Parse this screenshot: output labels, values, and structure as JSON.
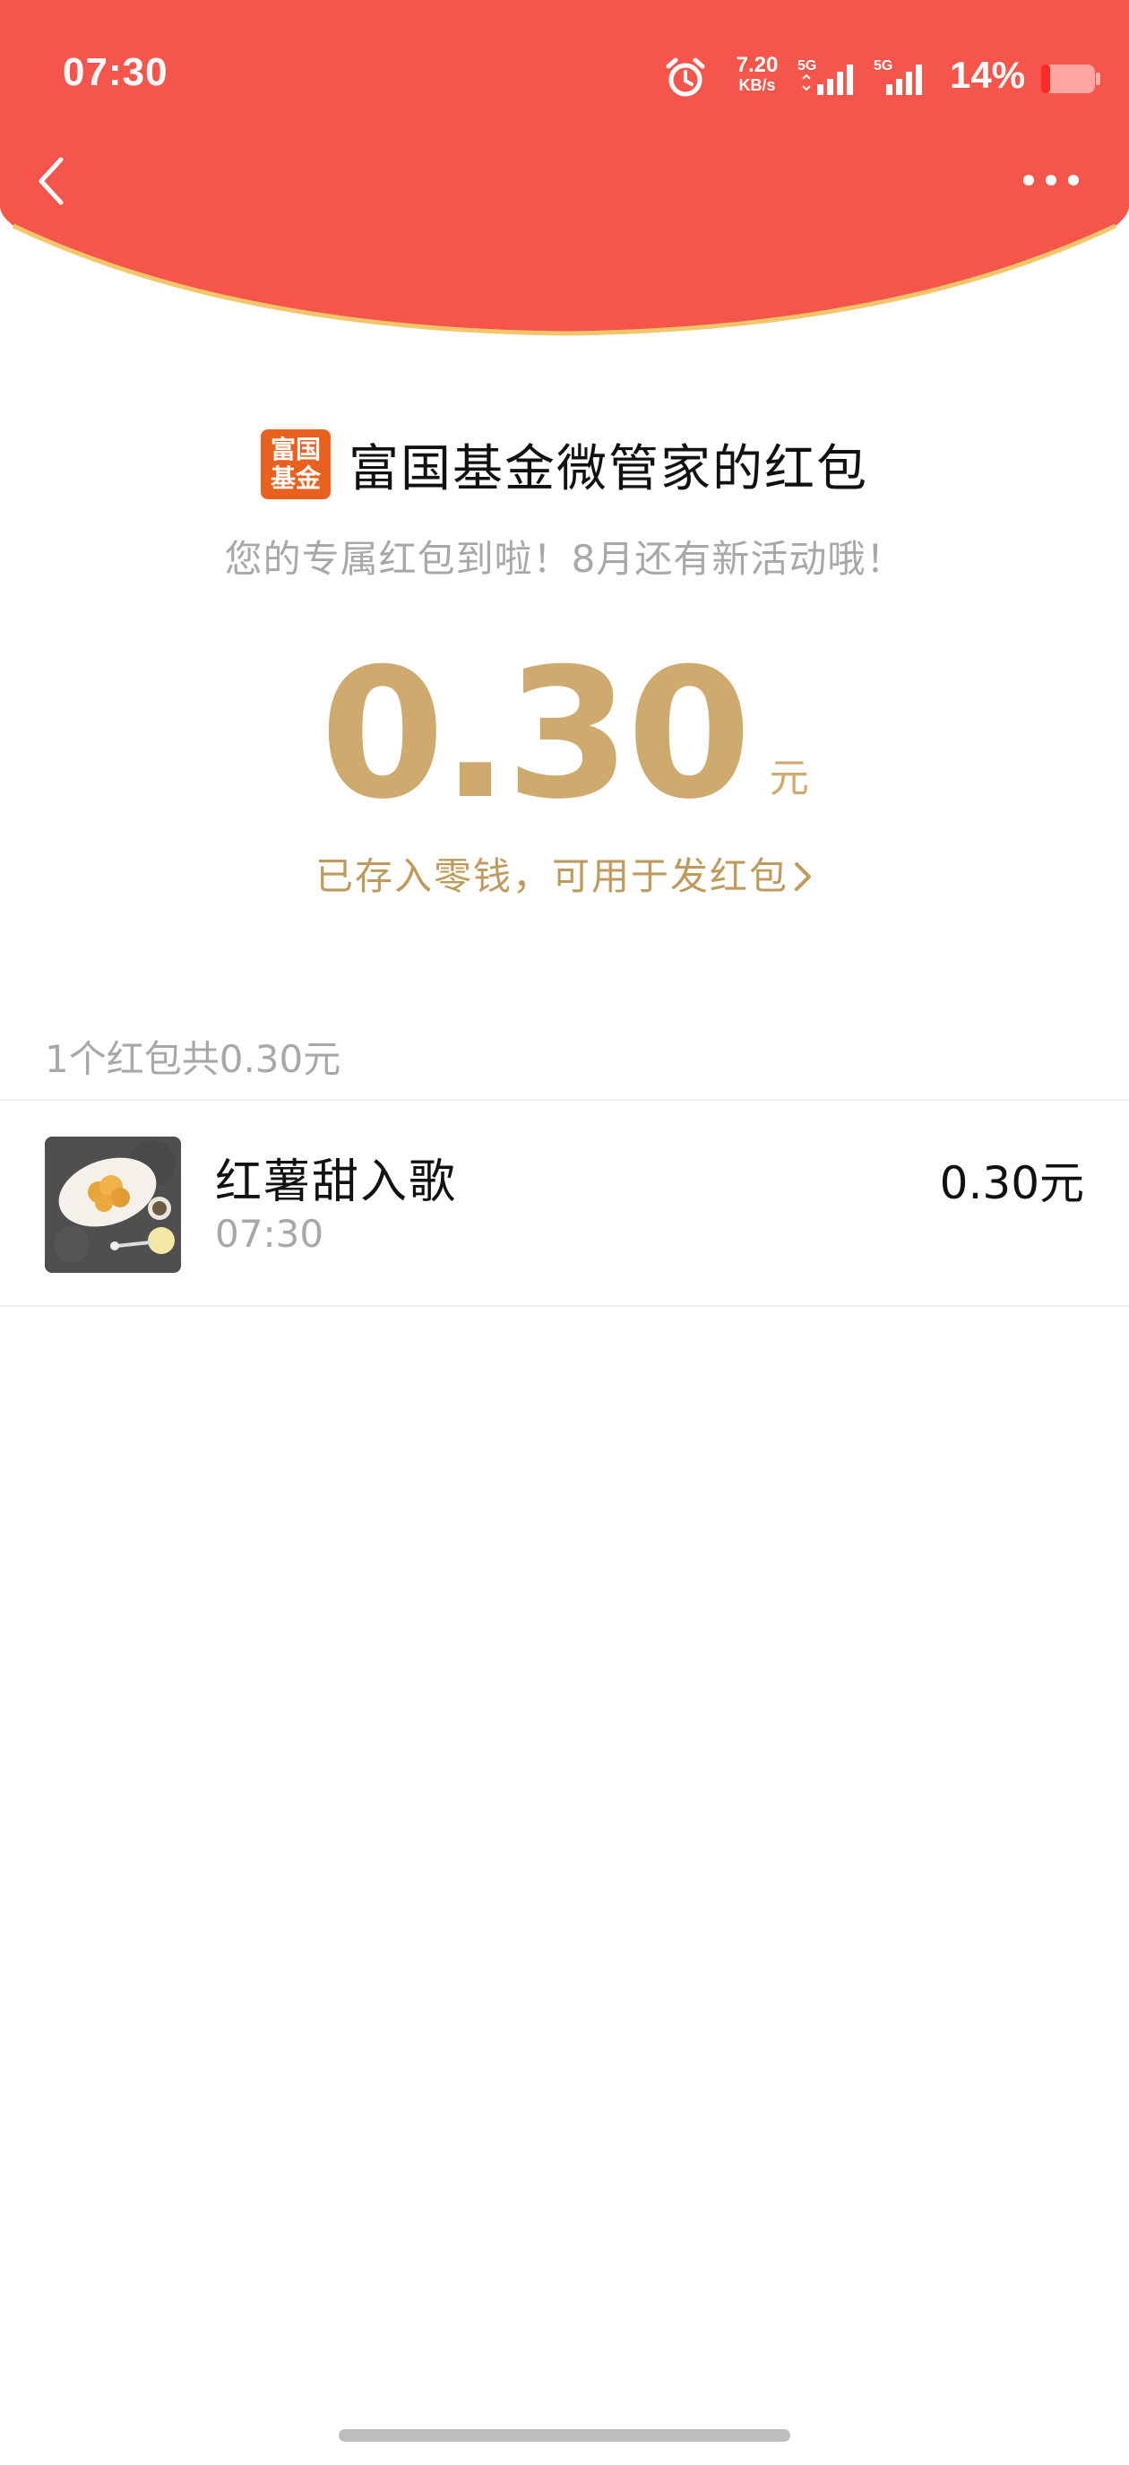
{
  "status_bar": {
    "time": "07:30",
    "net_speed_value": "7.20",
    "net_speed_unit": "KB/s",
    "signal1_label": "5G",
    "signal2_label": "5G",
    "battery": "14%"
  },
  "packet": {
    "title": "富国基金微管家的红包",
    "logo_text_top": "富国",
    "logo_text_bottom": "基金",
    "subtitle": "您的专属红包到啦！8月还有新活动哦！",
    "amount": "0.30",
    "amount_unit": "元",
    "deposit_note": "已存入零钱，可用于发红包"
  },
  "summary": "1个红包共0.30元",
  "records": [
    {
      "name": "红薯甜入歌",
      "time": "07:30",
      "amount": "0.30元"
    }
  ],
  "colors": {
    "header_red": "#f5554a",
    "header_edge": "#f3c66a",
    "gold": "#cfaa6e",
    "logo_orange": "#e8611f"
  }
}
